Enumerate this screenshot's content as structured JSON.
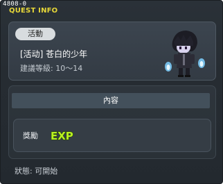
{
  "window": {
    "quest_id": "4808-0",
    "title": "QUEST INFO"
  },
  "info": {
    "tag": "活動",
    "quest_name": "[活动] 苍白的少年",
    "level_label": "建議等級: 10～14"
  },
  "content": {
    "header": "內容",
    "reward_label": "獎勵",
    "exp_text": "EXP"
  },
  "status": {
    "text": "狀態:  可開始"
  },
  "colors": {
    "title": "#e8d838",
    "exp": "#b8f020",
    "panel": "#333b44"
  },
  "icons": {
    "npc": "pale-boy-npc-icon",
    "exp": "exp-icon"
  }
}
